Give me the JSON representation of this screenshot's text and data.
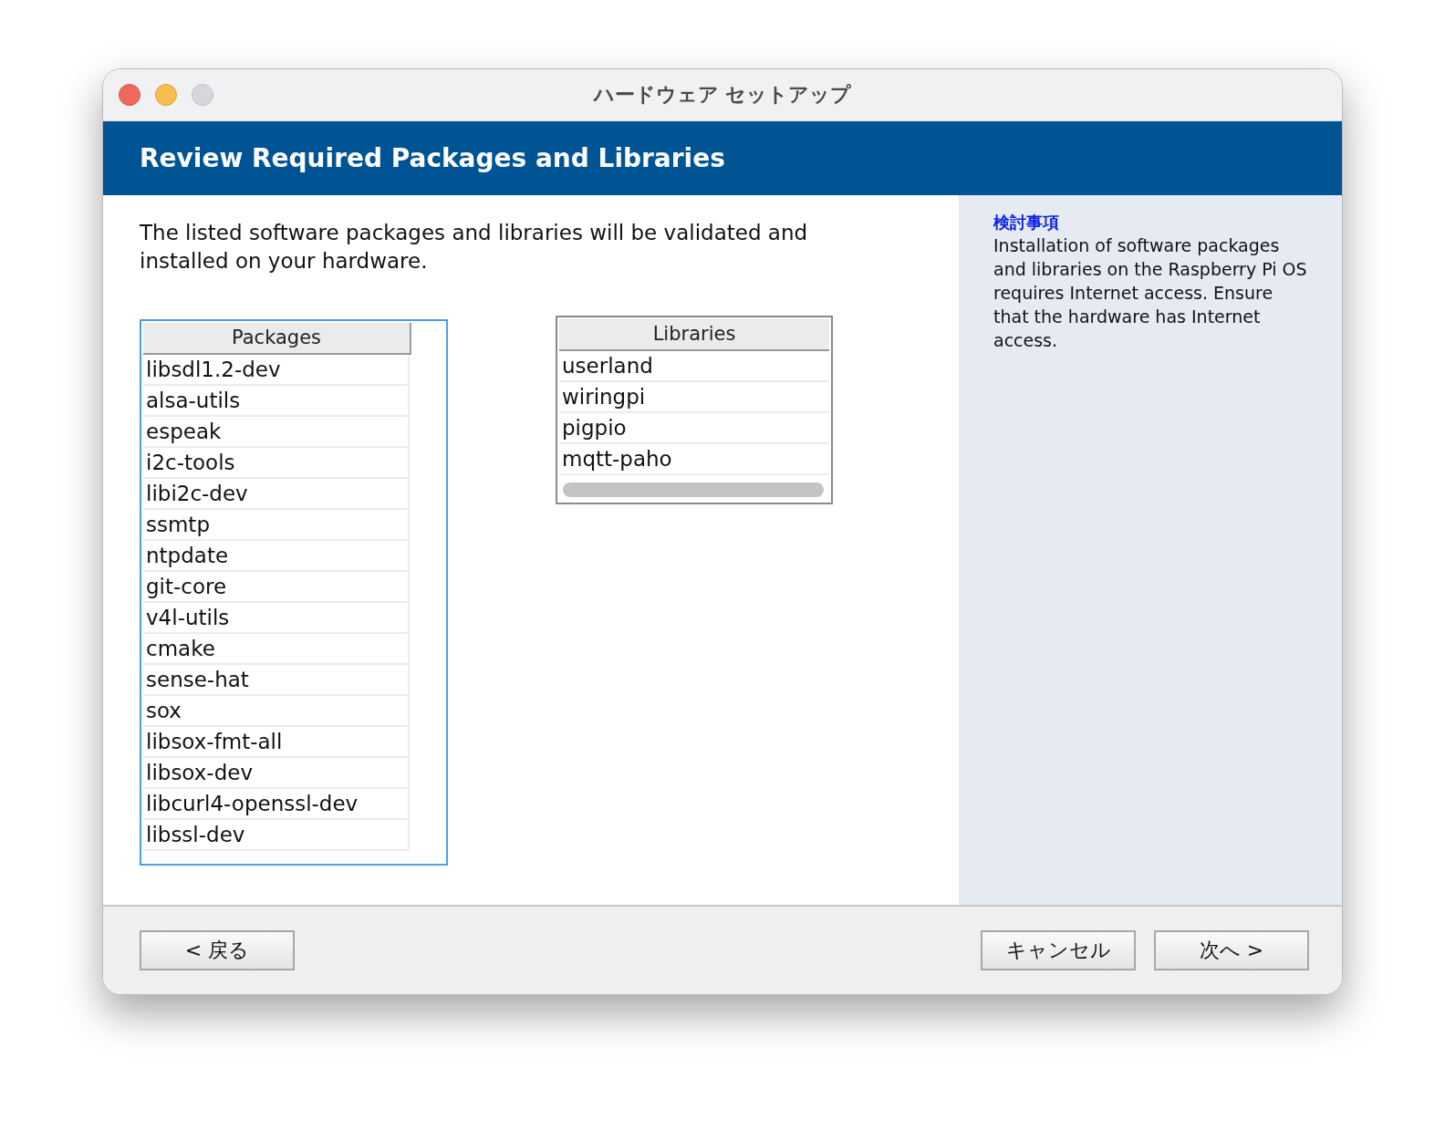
{
  "window": {
    "title": "ハードウェア セットアップ"
  },
  "header": {
    "title": "Review Required Packages and Libraries"
  },
  "intro": "The listed software packages and libraries will be validated and installed on your hardware.",
  "tables": [
    {
      "heading": "Packages",
      "focused": true,
      "scrollbar": false,
      "rows": [
        "libsdl1.2-dev",
        "alsa-utils",
        "espeak",
        "i2c-tools",
        "libi2c-dev",
        "ssmtp",
        "ntpdate",
        "git-core",
        "v4l-utils",
        "cmake",
        "sense-hat",
        "sox",
        "libsox-fmt-all",
        "libsox-dev",
        "libcurl4-openssl-dev",
        "libssl-dev"
      ]
    },
    {
      "heading": "Libraries",
      "focused": false,
      "scrollbar": true,
      "rows": [
        "userland",
        "wiringpi",
        "pigpio",
        "mqtt-paho"
      ]
    }
  ],
  "help": {
    "title": "検討事項",
    "body": "Installation of software packages and libraries on the Raspberry Pi OS requires Internet access. Ensure that the hardware has Internet access."
  },
  "footer": {
    "back_button": "< 戻る",
    "cancel_button": "キャンセル",
    "next_button": "次へ >"
  }
}
